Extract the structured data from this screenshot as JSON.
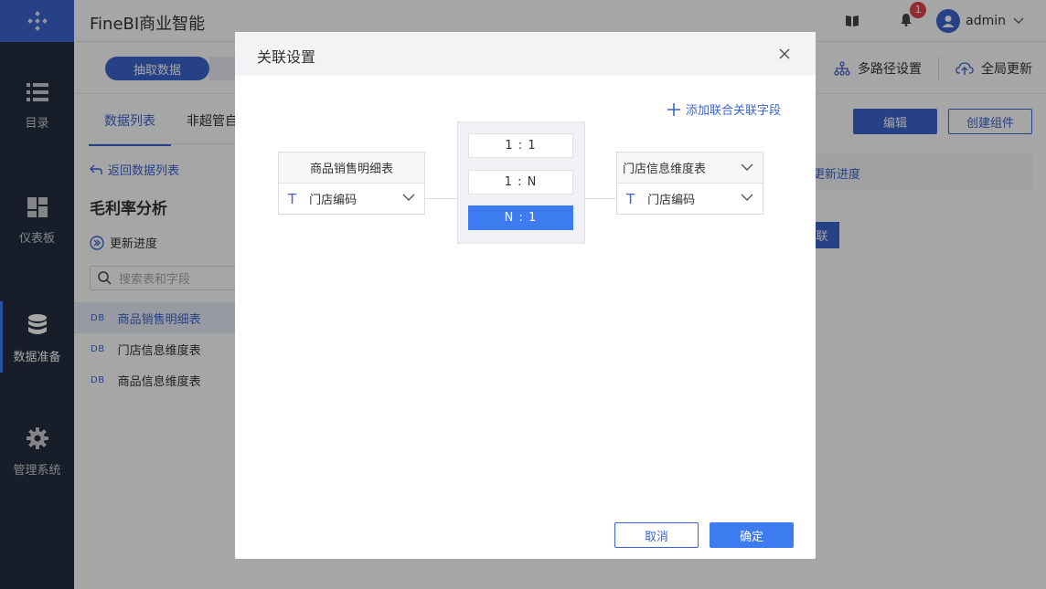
{
  "app": {
    "title": "FineBI商业智能"
  },
  "header": {
    "user": "admin",
    "notification_count": "1"
  },
  "sidebar": {
    "items": [
      {
        "label": "目录",
        "icon": "list-icon"
      },
      {
        "label": "仪表板",
        "icon": "dashboard-icon"
      },
      {
        "label": "数据准备",
        "icon": "database-icon",
        "active": true
      },
      {
        "label": "管理系统",
        "icon": "gear-icon"
      }
    ]
  },
  "left_panel": {
    "extract_button": "抽取数据",
    "tabs": [
      "数据列表",
      "非超管自"
    ],
    "back_link": "返回数据列表",
    "package_title": "毛利率分析",
    "update_progress": "更新进度",
    "search_placeholder": "搜索表和字段",
    "tables": [
      {
        "tag": "DB",
        "name": "商品销售明细表"
      },
      {
        "tag": "DB",
        "name": "门店信息维度表"
      },
      {
        "tag": "DB",
        "name": "商品信息维度表"
      }
    ]
  },
  "right_tools": {
    "multi_path": "多路径设置",
    "global_update": "全局更新",
    "edit": "编辑",
    "create_component": "创建组件",
    "update_progress_partial": "更新进度",
    "chip_partial": "联"
  },
  "dialog": {
    "title": "关联设置",
    "add_field": "添加联合关联字段",
    "left_table": {
      "name": "商品销售明细表",
      "field": "门店编码"
    },
    "right_table": {
      "name": "门店信息维度表",
      "field": "门店编码"
    },
    "relations": [
      "1 : 1",
      "1 : N",
      "N : 1"
    ],
    "selected_relation": "N : 1",
    "cancel": "取消",
    "confirm": "确定"
  },
  "colors": {
    "brand": "#3c64ce",
    "accent": "#3c7bf0",
    "sidebar": "#242f3f"
  }
}
